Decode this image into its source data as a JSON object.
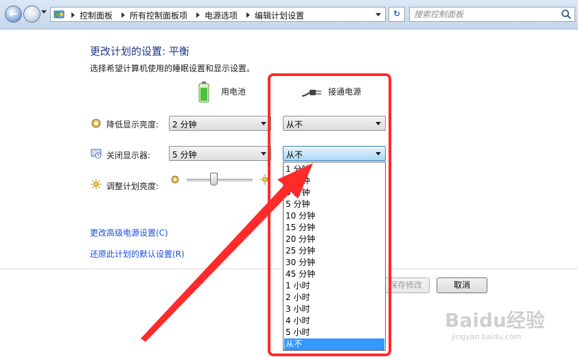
{
  "address_bar": {
    "breadcrumbs": [
      "控制面板",
      "所有控制面板项",
      "电源选项",
      "编辑计划设置"
    ],
    "search_placeholder": "搜索控制面板"
  },
  "page": {
    "title": "更改计划的设置: 平衡",
    "subtitle": "选择希望计算机使用的睡眠设置和显示设置。",
    "col_battery": "用电池",
    "col_plugged": "接通电源"
  },
  "rows": {
    "dim": {
      "label": "降低显示亮度:",
      "battery_value": "2 分钟",
      "plugged_value": "从不"
    },
    "off": {
      "label": "关闭显示器:",
      "battery_value": "5 分钟",
      "plugged_value": "从不"
    },
    "brightness": {
      "label": "调整计划亮度:",
      "battery_level_percent": 40
    }
  },
  "dropdown_options": [
    "1 分钟",
    "2 分钟",
    "3 分钟",
    "5 分钟",
    "10 分钟",
    "15 分钟",
    "20 分钟",
    "25 分钟",
    "30 分钟",
    "45 分钟",
    "1 小时",
    "2 小时",
    "3 小时",
    "4 小时",
    "5 小时",
    "从不"
  ],
  "dropdown_selected_index": 15,
  "links": {
    "advanced": "更改高级电源设置(C)",
    "restore": "还原此计划的默认设置(R)"
  },
  "buttons": {
    "save": "保存修改",
    "cancel": "取消"
  },
  "watermark": {
    "brand": "Baidu经验",
    "url": "jingyan.baidu.com"
  },
  "colors": {
    "annotation_red": "#ff2a2a",
    "link_blue": "#1a4ed8",
    "title_blue": "#1e3287",
    "selection_blue": "#3399ff"
  }
}
